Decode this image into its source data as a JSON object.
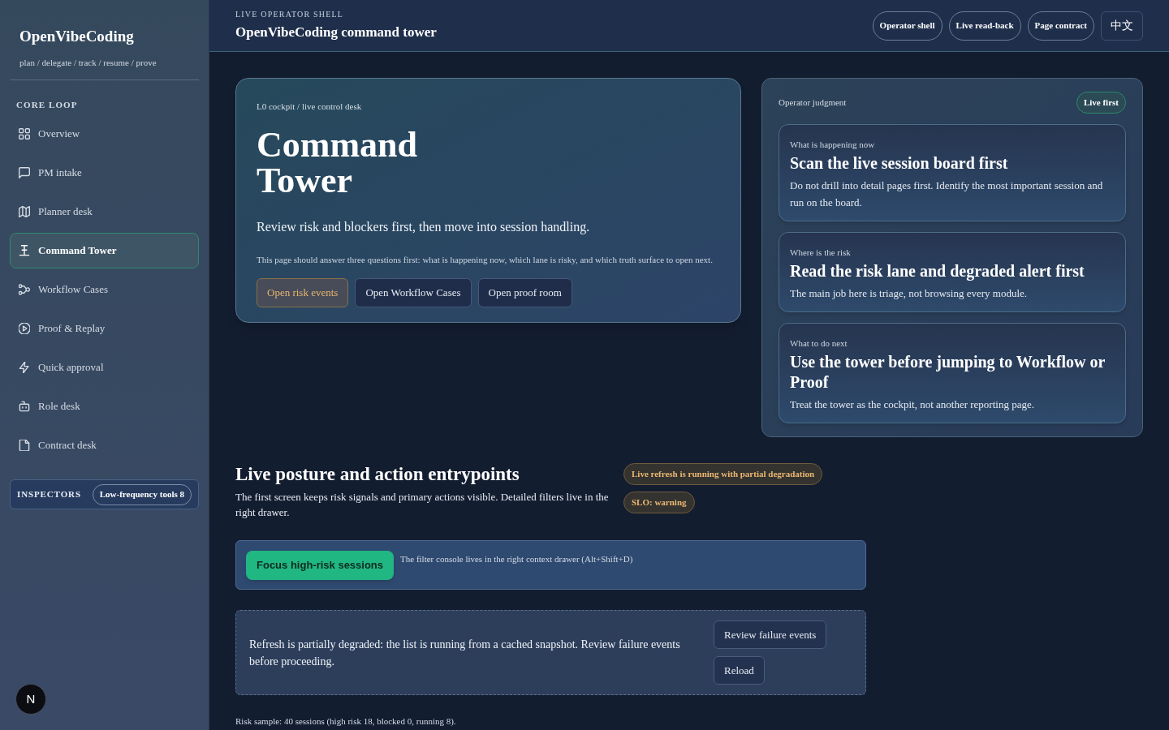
{
  "sidebar": {
    "brand": "OpenVibeCoding",
    "tagline": "plan / delegate / track / resume / prove",
    "section_title": "CORE LOOP",
    "items": [
      {
        "label": "Overview",
        "selected": false
      },
      {
        "label": "PM intake",
        "selected": false
      },
      {
        "label": "Planner desk",
        "selected": false
      },
      {
        "label": "Command Tower",
        "selected": true
      },
      {
        "label": "Workflow Cases",
        "selected": false
      },
      {
        "label": "Proof & Replay",
        "selected": false
      },
      {
        "label": "Quick approval",
        "selected": false
      },
      {
        "label": "Role desk",
        "selected": false
      },
      {
        "label": "Contract desk",
        "selected": false
      }
    ],
    "inspectors": {
      "label": "INSPECTORS",
      "button": "Low-frequency tools 8"
    },
    "dev_badge": "N"
  },
  "header": {
    "eyebrow": "LIVE OPERATOR SHELL",
    "title": "OpenVibeCoding command tower",
    "buttons": [
      {
        "label": "Operator shell",
        "kind": "pill"
      },
      {
        "label": "Live read-back",
        "kind": "pill"
      },
      {
        "label": "Page contract",
        "kind": "pill"
      },
      {
        "label": "中文",
        "kind": "square"
      }
    ]
  },
  "hero": {
    "eyebrow": "L0 cockpit / live control desk",
    "title": "Command Tower",
    "subtitle": "Review risk and blockers first, then move into session handling.",
    "note": "This page should answer three questions first: what is happening now, which lane is risky, and which truth surface to open next.",
    "buttons": [
      {
        "label": "Open risk events",
        "kind": "warning"
      },
      {
        "label": "Open Workflow Cases",
        "kind": "default"
      },
      {
        "label": "Open proof room",
        "kind": "default"
      }
    ]
  },
  "judgment": {
    "title": "Operator judgment",
    "badge": "Live first",
    "cards": [
      {
        "label": "What is happening now",
        "title": "Scan the live session board first",
        "body": "Do not drill into detail pages first. Identify the most important session and run on the board."
      },
      {
        "label": "Where is the risk",
        "title": "Read the risk lane and degraded alert first",
        "body": "The main job here is triage, not browsing every module."
      },
      {
        "label": "What to do next",
        "title": "Use the tower before jumping to Workflow or Proof",
        "body": "Treat the tower as the cockpit, not another reporting page."
      }
    ]
  },
  "posture": {
    "title": "Live posture and action entrypoints",
    "description": "The first screen keeps risk signals and primary actions visible. Detailed filters live in the right drawer.",
    "badges": [
      "Live refresh is running with partial degradation",
      "SLO: warning"
    ],
    "filter_bar": {
      "button": "Focus high-risk sessions",
      "note": "The filter console lives in the right context drawer (Alt+Shift+D)"
    },
    "alert": {
      "message": "Refresh is partially degraded: the list is running from a cached snapshot. Review failure events before proceeding.",
      "buttons": [
        "Review failure events",
        "Reload"
      ]
    },
    "footer": "Risk sample: 40 sessions (high risk 18, blocked 0, running 8)."
  }
}
